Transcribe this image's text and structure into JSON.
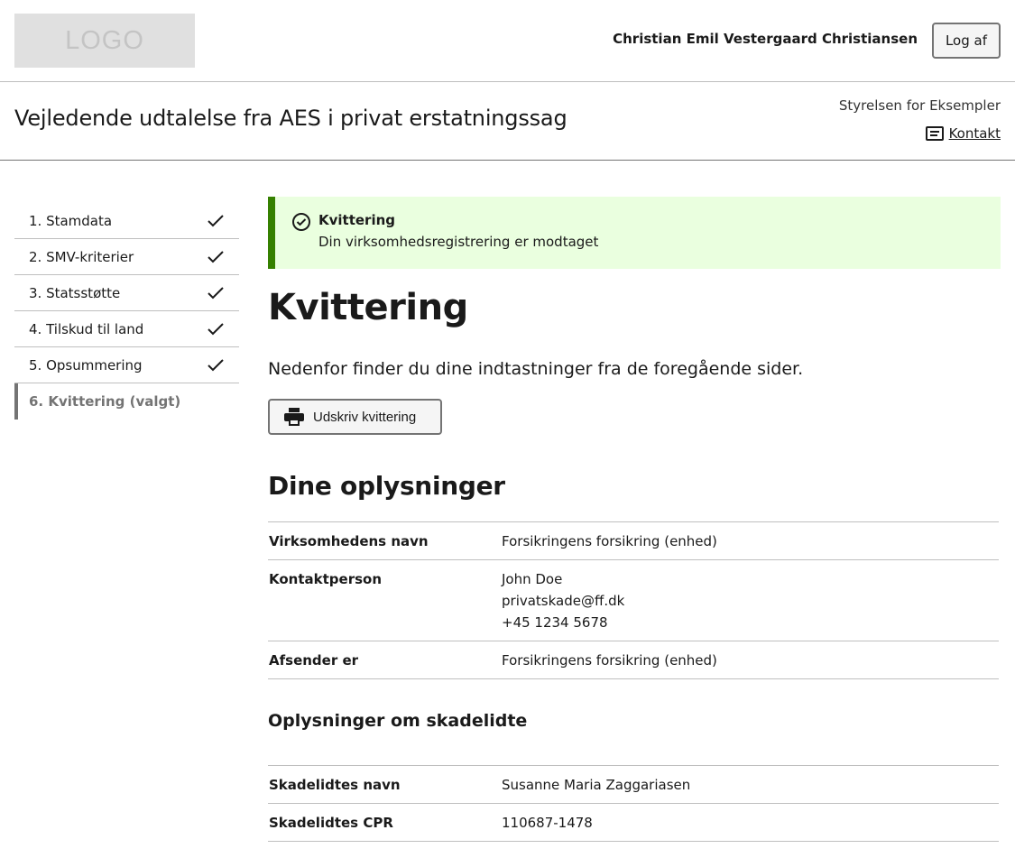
{
  "header": {
    "logo_text": "LOGO",
    "user_name": "Christian Emil Vestergaard Christiansen",
    "logout_label": "Log af"
  },
  "titlebar": {
    "title": "Vejledende udtalelse fra AES i privat erstatningssag",
    "authority": "Styrelsen for Eksempler",
    "contact_label": "Kontakt"
  },
  "steps": [
    {
      "label": "1. Stamdata",
      "done": true
    },
    {
      "label": "2. SMV-kriterier",
      "done": true
    },
    {
      "label": "3. Statsstøtte",
      "done": true
    },
    {
      "label": "4. Tilskud til land",
      "done": true
    },
    {
      "label": "5. Opsummering",
      "done": true
    },
    {
      "label": "6. Kvittering (valgt)",
      "done": false,
      "active": true
    }
  ],
  "alert": {
    "title": "Kvittering",
    "text": "Din virksomhedsregistrering er modtaget",
    "color_bg": "#eaffdf",
    "color_border": "#358000"
  },
  "main": {
    "heading": "Kvittering",
    "lead": "Nedenfor finder du dine indtastninger fra de foregående sider.",
    "print_label": "Udskriv kvittering",
    "section_heading": "Dine oplysninger",
    "info_rows": [
      {
        "key": "Virksomhedens navn",
        "value": [
          "Forsikringens forsikring (enhed)"
        ]
      },
      {
        "key": "Kontaktperson",
        "value": [
          "John Doe",
          "privatskade@ff.dk",
          "+45 1234 5678"
        ]
      },
      {
        "key": "Afsender er",
        "value": [
          "Forsikringens forsikring (enhed)"
        ]
      }
    ],
    "injured_heading": "Oplysninger om skadelidte",
    "injured_rows": [
      {
        "key": "Skadelidtes navn",
        "value": [
          "Susanne Maria Zaggariasen"
        ]
      },
      {
        "key": "Skadelidtes CPR",
        "value": [
          "110687-1478"
        ]
      }
    ]
  }
}
